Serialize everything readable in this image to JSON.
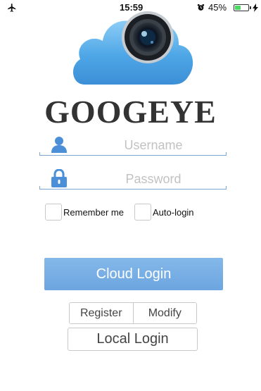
{
  "status_bar": {
    "time": "15:59",
    "battery_percent_label": "45%",
    "battery_level": 0.45,
    "icons": [
      "airplane-icon",
      "alarm-icon",
      "battery-icon",
      "charging-bolt-icon"
    ],
    "battery_color": "#4cd964"
  },
  "brand": {
    "name": "GOOGEYE",
    "logo": "cloud-camera-logo",
    "cloud_color": "#5aaae8"
  },
  "login_form": {
    "username_placeholder": "Username",
    "username_value": "",
    "password_placeholder": "Password",
    "password_value": "",
    "user_icon": "user-icon",
    "lock_icon": "lock-icon",
    "accent_color": "#4a8fd8"
  },
  "options": {
    "remember_label": "Remember me",
    "remember_checked": false,
    "autologin_label": "Auto-login",
    "autologin_checked": false
  },
  "buttons": {
    "cloud_login": "Cloud Login",
    "register": "Register",
    "modify": "Modify",
    "local_login": "Local Login",
    "primary_color": "#78afe5"
  }
}
